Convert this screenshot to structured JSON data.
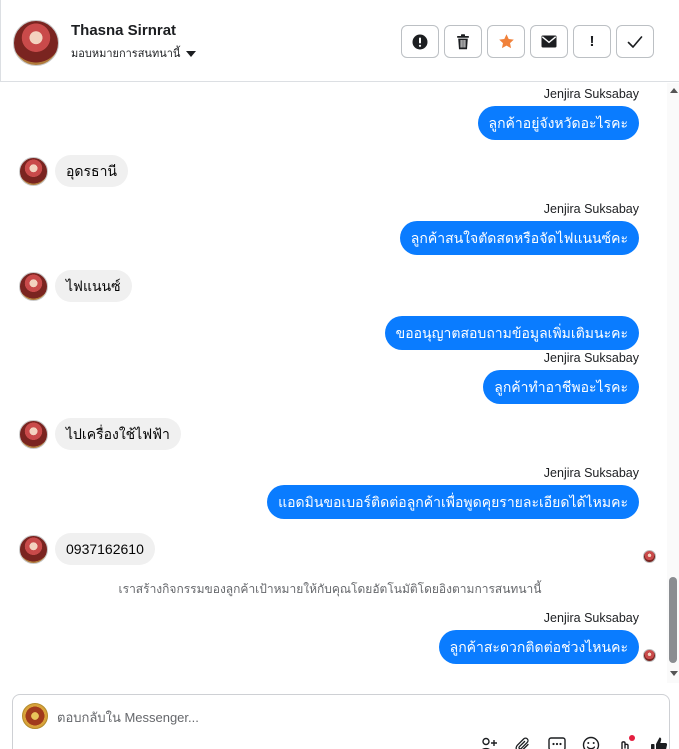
{
  "header": {
    "contact_name": "Thasna Sirnrat",
    "assign_label": "มอบหมายการสนทนานี้",
    "actions": [
      {
        "name": "report-spam-button",
        "icon": "exclamation-circle-icon"
      },
      {
        "name": "delete-button",
        "icon": "trash-icon"
      },
      {
        "name": "star-button",
        "icon": "star-icon"
      },
      {
        "name": "mark-unread-button",
        "icon": "envelope-icon"
      },
      {
        "name": "follow-up-button",
        "icon": "exclamation-icon",
        "label": "!"
      },
      {
        "name": "mark-done-button",
        "icon": "checkmark-icon"
      }
    ]
  },
  "colors": {
    "outgoing_bubble": "#0a7cff",
    "incoming_bubble": "#f0f0f0",
    "star": "#f0813a",
    "notification_dot": "#e41e3f"
  },
  "messages": [
    {
      "direction": "out",
      "sender": "Jenjira Suksabay",
      "text": "ลูกค้าอยู่จังหวัดอะไรคะ"
    },
    {
      "direction": "in",
      "text": "อุดรธานี"
    },
    {
      "direction": "out",
      "sender": "Jenjira Suksabay",
      "text": "ลูกค้าสนใจตัดสดหรือจัดไฟแนนซ์คะ"
    },
    {
      "direction": "in",
      "text": "ไฟแนนซ์"
    },
    {
      "direction": "out",
      "text": "ขออนุญาตสอบถามข้อมูลเพิ่มเติมนะคะ"
    },
    {
      "direction": "out",
      "sender": "Jenjira Suksabay",
      "text": "ลูกค้าทำอาชีพอะไรคะ"
    },
    {
      "direction": "in",
      "text": "ไปเครื่องใช้ไฟฟ้า"
    },
    {
      "direction": "out",
      "sender": "Jenjira Suksabay",
      "text": "แอดมินขอเบอร์ติดต่อลูกค้าเพื่อพูดคุยรายละเอียดได้ไหมคะ"
    },
    {
      "direction": "in",
      "text": "0937162610"
    },
    {
      "direction": "system",
      "text": "เราสร้างกิจกรรมของลูกค้าเป้าหมายให้กับคุณโดยอัตโนมัติโดยอิงตามการสนทนานี้"
    },
    {
      "direction": "out",
      "sender": "Jenjira Suksabay",
      "text": "ลูกค้าสะดวกติดต่อช่วงไหนคะ"
    }
  ],
  "composer": {
    "placeholder": "ตอบกลับใน Messenger...",
    "value": "",
    "tools": [
      "add-contact-icon",
      "attachment-icon",
      "saved-replies-icon",
      "emoji-icon",
      "appointment-icon",
      "like-icon"
    ]
  }
}
